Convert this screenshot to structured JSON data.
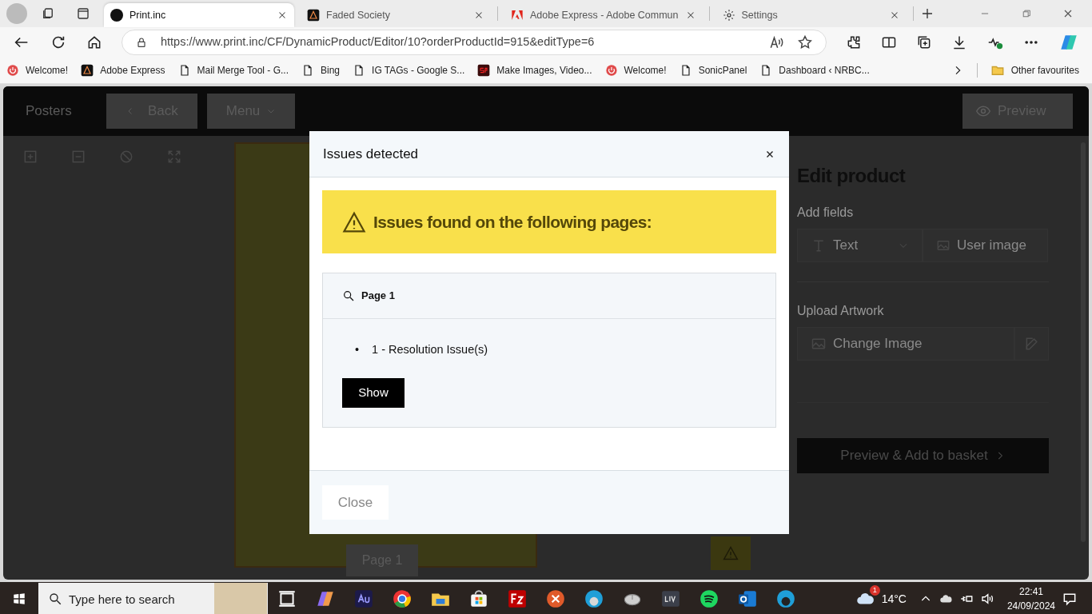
{
  "browser": {
    "tabs": [
      {
        "title": "Print.inc",
        "selected": true
      },
      {
        "title": "Faded Society",
        "selected": false
      },
      {
        "title": "Adobe Express - Adobe Commun",
        "selected": false
      },
      {
        "title": "Settings",
        "selected": false
      }
    ],
    "address": "https://www.print.inc/CF/DynamicProduct/Editor/10?orderProductId=915&editType=6",
    "bookmarks": [
      "Welcome!",
      "Adobe Express",
      "Mail Merge Tool - G...",
      "Bing",
      "IG TAGs - Google S...",
      "Make Images, Video...",
      "Welcome!",
      "SonicPanel",
      "Dashboard ‹ NRBC..."
    ],
    "other_favourites": "Other favourites"
  },
  "app": {
    "section": "Posters",
    "back": "Back",
    "menu": "Menu",
    "preview": "Preview",
    "page_label": "Page 1",
    "panel": {
      "title": "Edit product",
      "add_fields": "Add fields",
      "text_field": "Text",
      "user_image": "User image",
      "upload_artwork": "Upload Artwork",
      "change_image": "Change Image",
      "basket_button": "Preview & Add to basket"
    }
  },
  "modal": {
    "title": "Issues detected",
    "alert": "Issues found on the following pages:",
    "pages": [
      {
        "title": "Page 1",
        "bullet": "•",
        "issues": [
          "1 - Resolution Issue(s)"
        ],
        "button": "Show"
      }
    ],
    "close": "Close"
  },
  "taskbar": {
    "search_placeholder": "Type here to search",
    "weather_badge": "1",
    "temperature": "14°C",
    "time": "22:41",
    "date": "24/09/2024"
  }
}
